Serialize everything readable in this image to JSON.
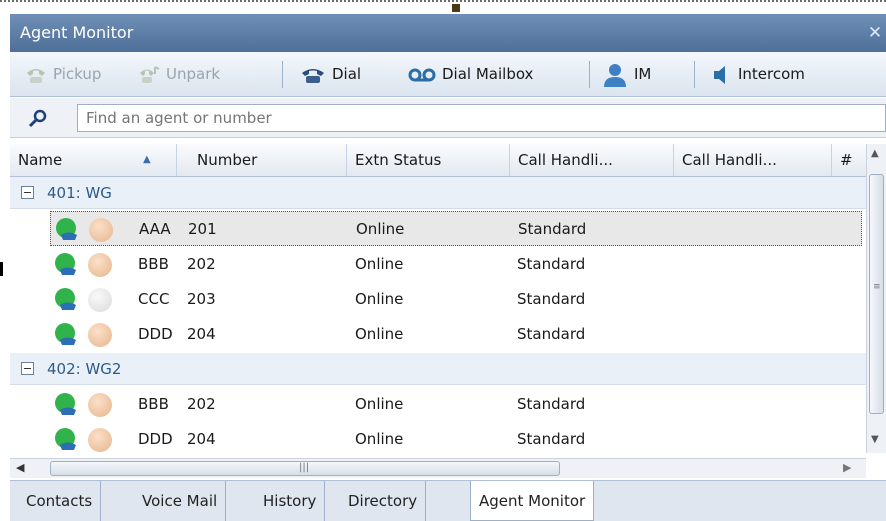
{
  "window": {
    "title": "Agent Monitor"
  },
  "toolbar": {
    "pickup_label": "Pickup",
    "unpark_label": "Unpark",
    "dial_label": "Dial",
    "dial_mailbox_label": "Dial Mailbox",
    "im_label": "IM",
    "intercom_label": "Intercom"
  },
  "search": {
    "placeholder": "Find an agent or number"
  },
  "columns": [
    "Name",
    "Number",
    "Extn Status",
    "Call Handli...",
    "Call Handli...",
    "#"
  ],
  "groups": [
    {
      "label": "401: WG",
      "agents": [
        {
          "name": "AAA",
          "number": "201",
          "extn_status": "Online",
          "call_handling": "Standard",
          "presence": "busy"
        },
        {
          "name": "BBB",
          "number": "202",
          "extn_status": "Online",
          "call_handling": "Standard",
          "presence": "busy"
        },
        {
          "name": "CCC",
          "number": "203",
          "extn_status": "Online",
          "call_handling": "Standard",
          "presence": "unknown"
        },
        {
          "name": "DDD",
          "number": "204",
          "extn_status": "Online",
          "call_handling": "Standard",
          "presence": "busy"
        }
      ]
    },
    {
      "label": "402: WG2",
      "agents": [
        {
          "name": "BBB",
          "number": "202",
          "extn_status": "Online",
          "call_handling": "Standard",
          "presence": "busy"
        },
        {
          "name": "DDD",
          "number": "204",
          "extn_status": "Online",
          "call_handling": "Standard",
          "presence": "busy"
        }
      ]
    }
  ],
  "tabs": [
    "Contacts",
    "Voice Mail",
    "History",
    "Directory",
    "Agent Monitor"
  ],
  "active_tab": "Agent Monitor",
  "colors": {
    "title_bar": "#5a7aa3",
    "group_label": "#2c5a8c",
    "presence_busy": "#e7b48a",
    "presence_unknown": "#e6e6e6",
    "phone_green": "#2fb34a"
  }
}
